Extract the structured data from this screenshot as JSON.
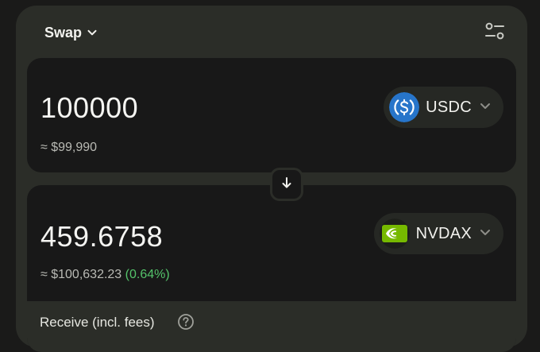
{
  "header": {
    "mode_label": "Swap",
    "mode_icon": "chevron-down-icon",
    "settings_icon": "sliders-icon"
  },
  "pay": {
    "amount": "100000",
    "fiat_value": "≈ $99,990",
    "token": {
      "symbol": "USDC",
      "logo": "usdc-logo",
      "logo_color": "#2775ca"
    }
  },
  "flip": {
    "icon": "arrow-down-icon"
  },
  "receive": {
    "amount": "459.6758",
    "fiat_value": "≈ $100,632.23",
    "fiat_change": "(0.64%)",
    "fiat_change_color": "#54c36a",
    "token": {
      "symbol": "NVDAX",
      "logo": "nvidia-logo",
      "logo_color": "#76b900"
    }
  },
  "details": {
    "receive_label": "Receive (incl. fees)",
    "help_icon": "question-circle-icon"
  }
}
